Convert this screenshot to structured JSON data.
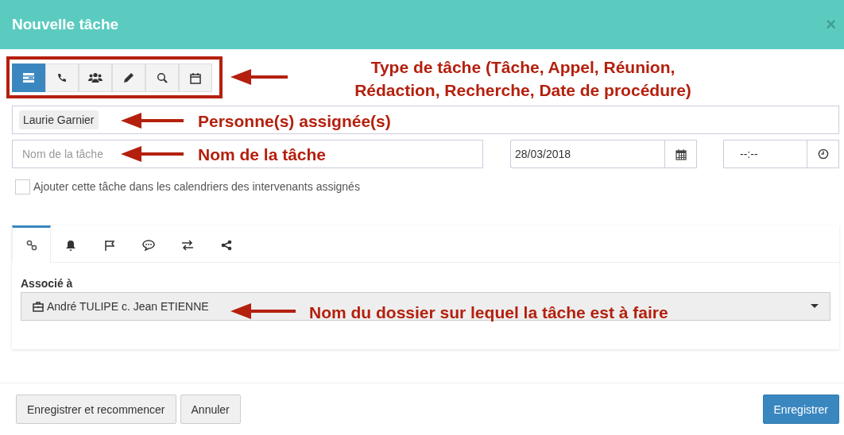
{
  "window": {
    "title": "Nouvelle tâche",
    "close": "×"
  },
  "task_types": [
    {
      "selected": true
    },
    {
      "selected": false
    },
    {
      "selected": false
    },
    {
      "selected": false
    },
    {
      "selected": false
    },
    {
      "selected": false
    }
  ],
  "assignees": [
    "Laurie Garnier"
  ],
  "task_name": {
    "placeholder": "Nom de la tâche"
  },
  "date": {
    "value": "28/03/2018"
  },
  "time": {
    "value": "--:--"
  },
  "calendar_option": {
    "label": "Ajouter cette tâche dans les calendriers des intervenants assignés",
    "checked": false
  },
  "tabs": [
    {
      "selected": true
    },
    {
      "selected": false
    },
    {
      "selected": false
    },
    {
      "selected": false
    },
    {
      "selected": false
    },
    {
      "selected": false
    }
  ],
  "associated": {
    "label": "Associé à",
    "value": "André TULIPE c. Jean ETIENNE"
  },
  "footer": {
    "left_buttons": [
      "Enregistrer et recommencer",
      "Annuler"
    ],
    "primary_button": "Enregistrer"
  },
  "annotations": [
    {
      "lines": [
        "Type de tâche (Tâche, Appel, Réunion,",
        "Rédaction, Recherche, Date de procédure)"
      ]
    },
    {
      "lines": [
        "Personne(s) assignée(s)"
      ]
    },
    {
      "lines": [
        "Nom de la tâche"
      ]
    },
    {
      "lines": [
        "Nom du dossier sur lequel la tâche est à faire"
      ]
    }
  ]
}
